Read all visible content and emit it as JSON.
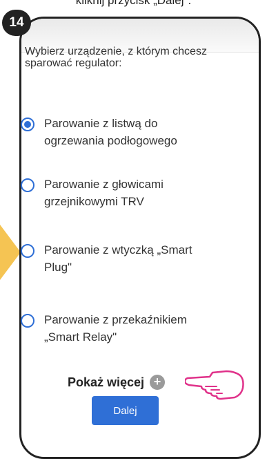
{
  "caption": "kliknij przycisk „Dalej\".",
  "step_number": "14",
  "prompt": "Wybierz urządzenie, z którym chcesz sparować regulator:",
  "options": [
    {
      "label": "Parowanie z listwą do ogrzewania podłogowego",
      "selected": true
    },
    {
      "label": "Parowanie z głowicami grzejnikowymi TRV",
      "selected": false
    },
    {
      "label": "Parowanie z wtyczką „Smart Plug\"",
      "selected": false
    },
    {
      "label": "Parowanie z przekaźnikiem „Smart Relay\"",
      "selected": false
    }
  ],
  "show_more_label": "Pokaż więcej",
  "show_more_icon": "+",
  "next_button_label": "Dalej",
  "colors": {
    "accent": "#2f6fd6",
    "badge": "#222222",
    "arrow": "#f5c453"
  }
}
